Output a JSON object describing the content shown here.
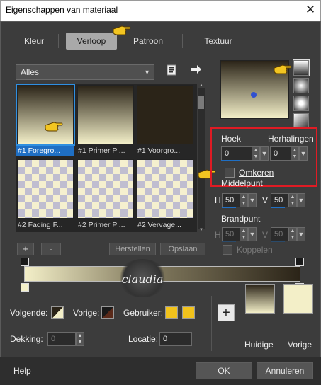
{
  "window": {
    "title": "Eigenschappen van materiaal",
    "close_glyph": "✕"
  },
  "tabs": [
    {
      "label": "Kleur"
    },
    {
      "label": "Verloop"
    },
    {
      "label": "Patroon"
    },
    {
      "label": "Textuur"
    }
  ],
  "library": {
    "category": "Alles",
    "items": [
      {
        "label": "#1 Foregro..."
      },
      {
        "label": "#1 Primer Pl..."
      },
      {
        "label": "#1 Voorgro..."
      },
      {
        "label": "#2 Fading F..."
      },
      {
        "label": "#2 Primer Pl..."
      },
      {
        "label": "#2 Vervage..."
      }
    ]
  },
  "controls": {
    "angle_label": "Hoek",
    "angle_value": "0",
    "repeats_label": "Herhalingen",
    "repeats_value": "0",
    "invert_label": "Omkeren",
    "center_label": "Middelpunt",
    "center_h": "50",
    "center_v": "50",
    "focal_label": "Brandpunt",
    "focal_h": "50",
    "focal_v": "50",
    "link_label": "Koppelen",
    "h_label": "H",
    "v_label": "V"
  },
  "editor": {
    "add_label": "+",
    "remove_label": "-",
    "reset_label": "Herstellen",
    "save_label": "Opslaan"
  },
  "bottom": {
    "next_label": "Volgende:",
    "prev_label": "Vorige:",
    "user_label": "Gebruiker:",
    "opacity_label": "Dekking:",
    "opacity_value": "0",
    "location_label": "Locatie:",
    "location_value": "0",
    "current_label": "Huidige",
    "previous_label": "Vorige",
    "plus_label": "+"
  },
  "footer": {
    "help_label": "Help",
    "ok_label": "OK",
    "cancel_label": "Annuleren"
  },
  "watermark": {
    "text": "claudia"
  },
  "colors": {
    "dark": "#2b2418",
    "light": "#f3efc8",
    "accent": "#1f6fc4",
    "highlight": "#e01b24",
    "user_yellow": "#f1c21b"
  }
}
